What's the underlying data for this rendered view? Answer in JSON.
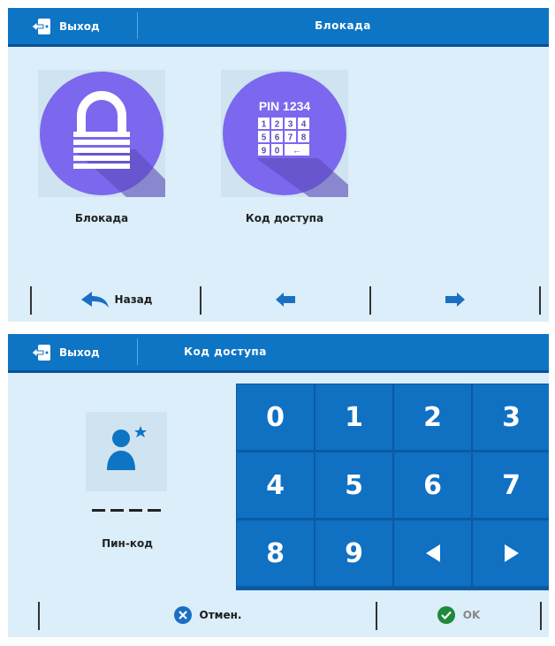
{
  "screen1": {
    "header": {
      "exit_label": "Выход",
      "title": "Блокада"
    },
    "tiles": [
      {
        "label": "Блокада",
        "icon": "padlock-icon"
      },
      {
        "label": "Код доступа",
        "icon": "pin-keypad-icon",
        "pin_text": "PIN 1234",
        "pin_keys": [
          "1",
          "2",
          "3",
          "4",
          "5",
          "6",
          "7",
          "8",
          "9",
          "0",
          "←"
        ]
      }
    ],
    "footer": {
      "back_label": "Назад",
      "prev_icon": "arrow-left-icon",
      "next_icon": "arrow-right-icon"
    }
  },
  "screen2": {
    "header": {
      "exit_label": "Выход",
      "title": "Код доступа"
    },
    "pin_label": "Пин-код",
    "pin_placeholder": "----",
    "keys": [
      "0",
      "1",
      "2",
      "3",
      "4",
      "5",
      "6",
      "7",
      "8",
      "9"
    ],
    "footer": {
      "cancel_label": "Отмен.",
      "ok_label": "OK"
    }
  },
  "colors": {
    "header_blue": "#0e74c4",
    "screen_bg": "#dbeefa",
    "tile_purple": "#7b68ee",
    "cancel_blue": "#1a6fc4",
    "ok_green": "#1e8a3c"
  }
}
